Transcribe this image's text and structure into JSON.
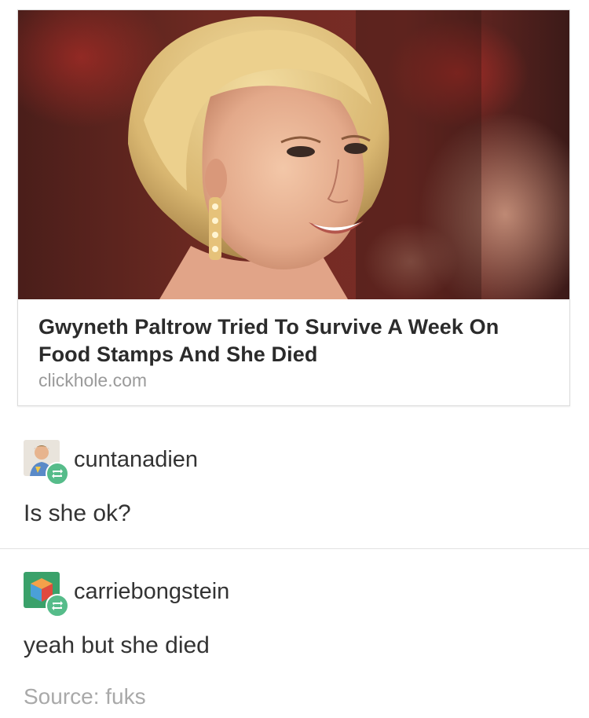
{
  "link_card": {
    "image_alt": "Photo of Gwyneth Paltrow smiling",
    "title": "Gwyneth Paltrow Tried To Survive A Week On Food Stamps And She Died",
    "domain": "clickhole.com"
  },
  "reblogs": [
    {
      "username": "cuntanadien",
      "avatar_icon": "user-avatar-illustrated",
      "badge_icon": "reblog-icon",
      "comment": "Is she ok?"
    },
    {
      "username": "carriebongstein",
      "avatar_icon": "cube-avatar",
      "badge_icon": "reblog-icon",
      "comment": "yeah but she died"
    }
  ],
  "source": {
    "label": "Source: fuks"
  },
  "colors": {
    "reblog_green": "#56bc8a",
    "avatar2_green": "#3aa16a"
  }
}
